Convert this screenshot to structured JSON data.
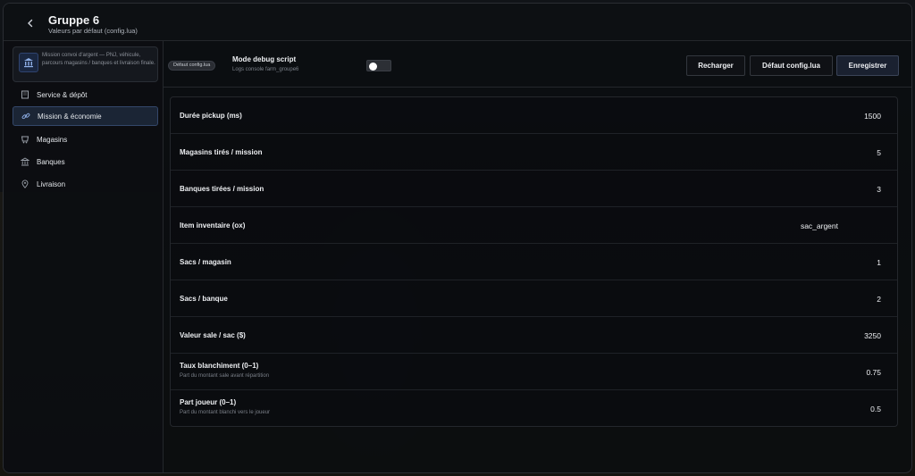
{
  "header": {
    "title": "Gruppe 6",
    "subtitle": "Valeurs par défaut (config.lua)"
  },
  "sidebar": {
    "description": "Mission convoi d'argent — PNJ, véhicule, parcours magasins / banques et livraison finale.",
    "items": [
      {
        "label": "Service & dépôt",
        "icon": "building-icon"
      },
      {
        "label": "Mission & économie",
        "icon": "link-icon",
        "active": true
      },
      {
        "label": "Magasins",
        "icon": "cart-icon"
      },
      {
        "label": "Banques",
        "icon": "bank-icon"
      },
      {
        "label": "Livraison",
        "icon": "pin-icon"
      }
    ]
  },
  "toolbar": {
    "badge": "Défaut config.lua",
    "debug_title": "Mode debug script",
    "debug_subtitle": "Logs console farm_groupe6",
    "debug_enabled": false,
    "reload_label": "Recharger",
    "default_label": "Défaut config.lua",
    "save_label": "Enregistrer"
  },
  "settings": [
    {
      "label": "Durée pickup (ms)",
      "hint": "",
      "value": "1500"
    },
    {
      "label": "Magasins tirés / mission",
      "hint": "",
      "value": "5"
    },
    {
      "label": "Banques tirées / mission",
      "hint": "",
      "value": "3"
    },
    {
      "label": "Item inventaire (ox)",
      "hint": "",
      "value": "sac_argent"
    },
    {
      "label": "Sacs / magasin",
      "hint": "",
      "value": "1"
    },
    {
      "label": "Sacs / banque",
      "hint": "",
      "value": "2"
    },
    {
      "label": "Valeur sale / sac ($)",
      "hint": "",
      "value": "3250"
    },
    {
      "label": "Taux blanchiment (0–1)",
      "hint": "Part du montant sale avant répartition",
      "value": "0.75"
    },
    {
      "label": "Part joueur (0–1)",
      "hint": "Part du montant blanchi vers le joueur",
      "value": "0.5"
    }
  ],
  "colors": {
    "accent": "#34476a",
    "background": "#0b0d10"
  }
}
